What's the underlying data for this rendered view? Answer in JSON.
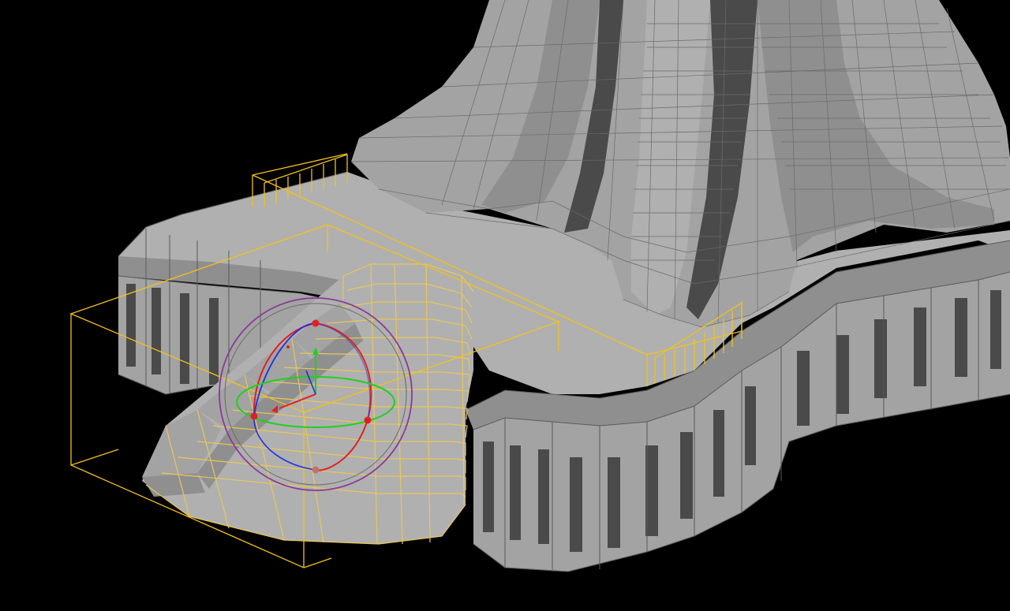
{
  "viewport": {
    "background": "#000000",
    "mesh_color": "#a3a3a3",
    "wireframe_color": "#5a5a5a",
    "selection_color": "#f2c21b",
    "gizmo_colors": {
      "x_axis": "#e02020",
      "y_axis": "#20d020",
      "z_axis": "#2030e0",
      "view_ring": "#8a3a9a",
      "sphere": "#7a7a7a"
    }
  }
}
